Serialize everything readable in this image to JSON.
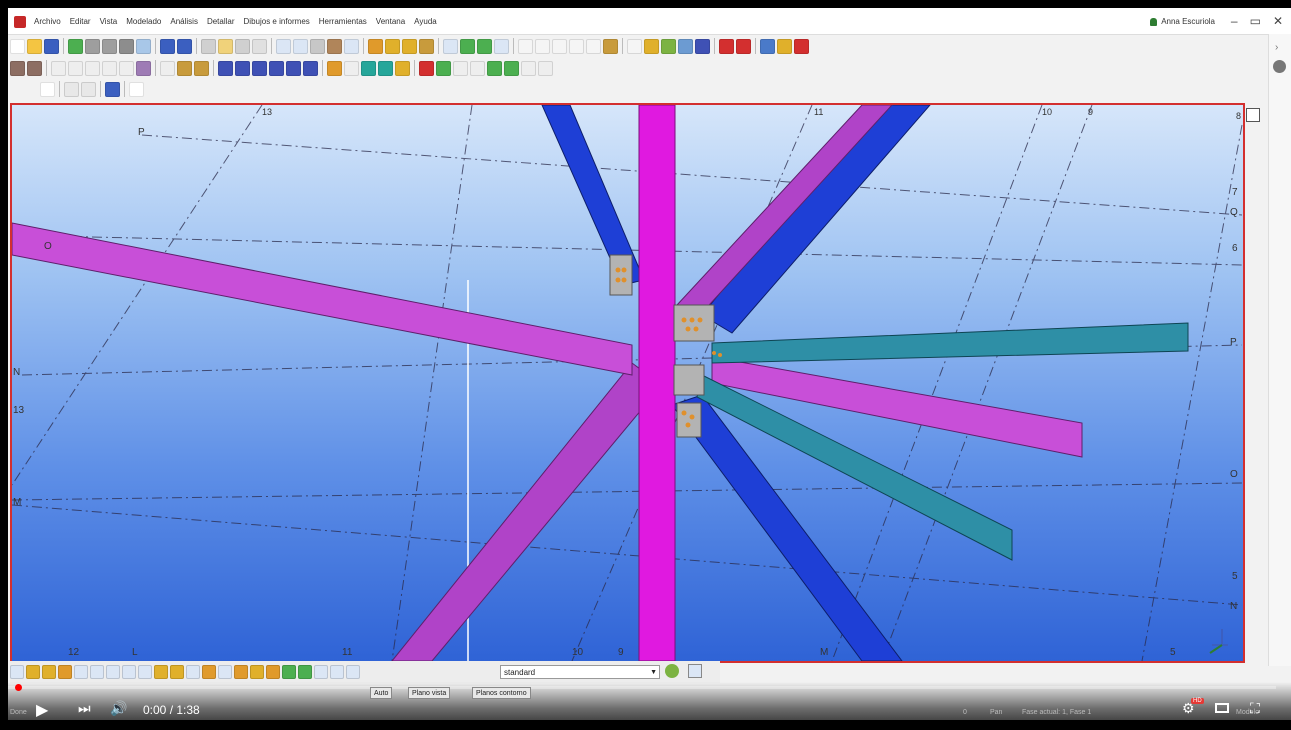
{
  "menu": {
    "items": [
      "Archivo",
      "Editar",
      "Vista",
      "Modelado",
      "Análisis",
      "Detallar",
      "Dibujos e informes",
      "Herramientas",
      "Ventana",
      "Ayuda"
    ]
  },
  "user": {
    "name": "Anna Escuriola"
  },
  "window_controls": {
    "minimize": "–",
    "restore": "▭",
    "close": "✕"
  },
  "right_panel": {
    "arrow": "›"
  },
  "view_labels": {
    "gridlines_top": [
      "13",
      "11",
      "10",
      "9",
      "8"
    ],
    "gridlines_left": [
      "P",
      "O",
      "N",
      "13",
      "M"
    ],
    "gridlines_right": [
      "7",
      "Q",
      "6",
      "P",
      "O",
      "5",
      "N"
    ],
    "gridlines_bottom": [
      "12",
      "L",
      "11",
      "10",
      "9",
      "M",
      "5"
    ]
  },
  "lower_toolbar": {
    "standard_select": "standard"
  },
  "status_bar": {
    "left": "Done",
    "auto": "Auto",
    "plano_vista": "Plano vista",
    "planos_contorno": "Planos contorno",
    "zero": "0",
    "pan": "Pan",
    "fase": "Fase actual: 1, Fase 1",
    "modelo": "Modelo"
  },
  "video": {
    "time": "0:00 / 1:38",
    "hd": "HD"
  },
  "colors": {
    "magenta": "#e019e0",
    "pink_beam": "#c84fd8",
    "blue_beam": "#1e3fd6",
    "teal_beam": "#2e8fa6",
    "border": "#d32f2f"
  }
}
